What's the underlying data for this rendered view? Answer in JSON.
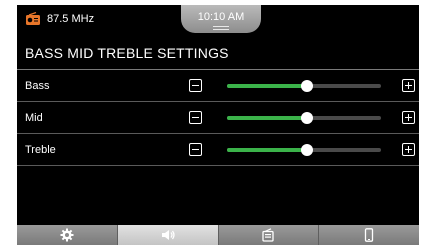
{
  "status": {
    "frequency": "87.5 MHz",
    "time": "10:10 AM"
  },
  "page": {
    "title": "BASS MID TREBLE SETTINGS"
  },
  "eq": [
    {
      "label": "Bass",
      "level": 0.52
    },
    {
      "label": "Mid",
      "level": 0.52
    },
    {
      "label": "Treble",
      "level": 0.52
    }
  ],
  "nav": {
    "tabs": [
      {
        "icon": "gear-icon",
        "active": false
      },
      {
        "icon": "speaker-icon",
        "active": true
      },
      {
        "icon": "radio-icon",
        "active": false
      },
      {
        "icon": "phone-icon",
        "active": false
      }
    ]
  },
  "colors": {
    "accent": "#3bb34a",
    "radio_icon": "#e8762a"
  }
}
